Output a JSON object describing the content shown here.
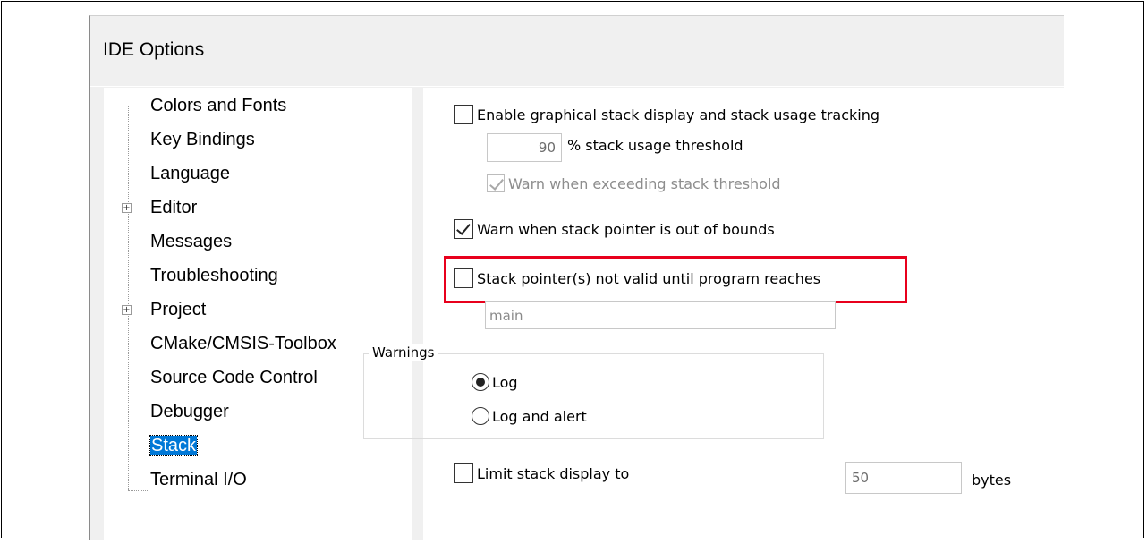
{
  "dialog": {
    "title": "IDE Options"
  },
  "tree": {
    "items": [
      {
        "label": "Colors and Fonts",
        "expandable": false
      },
      {
        "label": "Key Bindings",
        "expandable": false
      },
      {
        "label": "Language",
        "expandable": false
      },
      {
        "label": "Editor",
        "expandable": true
      },
      {
        "label": "Messages",
        "expandable": false
      },
      {
        "label": "Troubleshooting",
        "expandable": false
      },
      {
        "label": "Project",
        "expandable": true
      },
      {
        "label": "CMake/CMSIS-Toolbox",
        "expandable": false
      },
      {
        "label": "Source Code Control",
        "expandable": false
      },
      {
        "label": "Debugger",
        "expandable": false
      },
      {
        "label": "Stack",
        "expandable": false,
        "selected": true
      },
      {
        "label": "Terminal I/O",
        "expandable": false
      }
    ],
    "expander_glyph": "+"
  },
  "stack": {
    "enable_graphical": {
      "label": "Enable graphical stack display and stack usage tracking",
      "checked": false
    },
    "threshold": {
      "value": "90",
      "label": "% stack usage threshold"
    },
    "warn_exceeding": {
      "label": "Warn when exceeding stack threshold",
      "checked": true,
      "enabled": false
    },
    "warn_out_of_bounds": {
      "label": "Warn when stack pointer is out of bounds",
      "checked": true
    },
    "sp_not_valid": {
      "label": "Stack pointer(s) not valid until program reaches",
      "checked": false
    },
    "function_name": {
      "value": "main"
    },
    "warnings": {
      "group_label": "Warnings",
      "options": [
        {
          "label": "Log",
          "selected": true
        },
        {
          "label": "Log and alert",
          "selected": false
        }
      ]
    },
    "limit_display": {
      "label": "Limit stack display to",
      "checked": false,
      "value": "50",
      "unit": "bytes"
    }
  },
  "colors": {
    "highlight_border": "#e8001c",
    "selection": "#0078d7"
  }
}
